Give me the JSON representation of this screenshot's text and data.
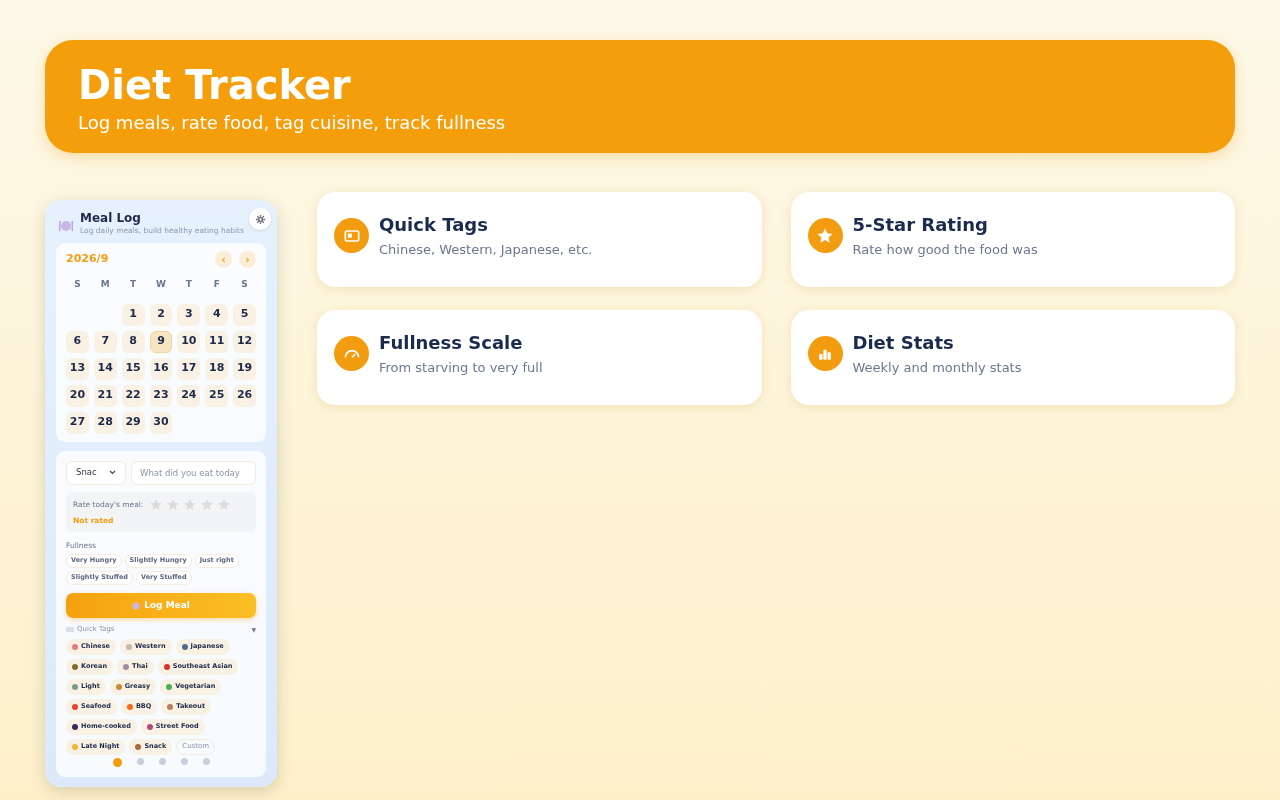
{
  "header": {
    "title": "Diet Tracker",
    "subtitle": "Log meals, rate food, tag cuisine, track fullness"
  },
  "phone": {
    "title": "Meal Log",
    "subtitle": "Log daily meals, build healthy eating habits",
    "calendar": {
      "month": "2026/9",
      "prev": "‹",
      "next": "›",
      "weekdays": [
        "S",
        "M",
        "T",
        "W",
        "T",
        "F",
        "S"
      ],
      "weeks": [
        [
          {
            "day": "1",
            "selected": false
          },
          {
            "day": "2",
            "selected": false
          },
          {
            "day": "3",
            "selected": false
          },
          {
            "day": "4",
            "selected": false
          },
          {
            "day": "5",
            "selected": false
          }
        ],
        [
          {
            "day": "6",
            "selected": false
          },
          {
            "day": "7",
            "selected": false
          },
          {
            "day": "8",
            "selected": false
          },
          {
            "day": "9",
            "selected": true
          },
          {
            "day": "10",
            "selected": false
          },
          {
            "day": "11",
            "selected": false
          },
          {
            "day": "12",
            "selected": false
          }
        ],
        [
          {
            "day": "13",
            "selected": false
          },
          {
            "day": "14",
            "selected": false
          },
          {
            "day": "15",
            "selected": false
          },
          {
            "day": "16",
            "selected": false
          },
          {
            "day": "17",
            "selected": false
          },
          {
            "day": "18",
            "selected": false
          },
          {
            "day": "19",
            "selected": false
          }
        ],
        [
          {
            "day": "20",
            "selected": false
          },
          {
            "day": "21",
            "selected": false
          },
          {
            "day": "22",
            "selected": false
          },
          {
            "day": "23",
            "selected": false
          },
          {
            "day": "24",
            "selected": false
          },
          {
            "day": "25",
            "selected": false
          },
          {
            "day": "26",
            "selected": false
          }
        ],
        [
          {
            "day": "27",
            "selected": false
          },
          {
            "day": "28",
            "selected": false
          },
          {
            "day": "29",
            "selected": false
          },
          {
            "day": "30",
            "selected": false
          }
        ]
      ]
    },
    "meal_type": "Snac",
    "food_placeholder": "What did you eat today",
    "rating": {
      "label": "Rate today's meal:",
      "stars": 0,
      "status": "Not rated"
    },
    "fullness": {
      "label": "Fullness",
      "options": [
        {
          "label": "Very Hungry",
          "selected": false
        },
        {
          "label": "Slightly Hungry",
          "selected": false
        },
        {
          "label": "Just right",
          "selected": false
        },
        {
          "label": "Slightly Stuffed",
          "selected": false
        },
        {
          "label": "Very Stuffed",
          "selected": false
        }
      ]
    },
    "log_button": "Log Meal",
    "quick_tags": {
      "label": "Quick Tags",
      "toggle": "▼",
      "expanded": true,
      "tags": [
        {
          "label": "Chinese",
          "kind": "tag",
          "color": "#e87a7a"
        },
        {
          "label": "Western",
          "kind": "tag",
          "color": "#c9b8a8"
        },
        {
          "label": "Japanese",
          "kind": "tag",
          "color": "#4f6b8a"
        },
        {
          "label": "Korean",
          "kind": "tag",
          "color": "#8a6a2a"
        },
        {
          "label": "Thai",
          "kind": "tag",
          "color": "#9c8fa8"
        },
        {
          "label": "Southeast Asian",
          "kind": "tag",
          "color": "#d9302a"
        },
        {
          "label": "Light",
          "kind": "tag",
          "color": "#7a9a8a"
        },
        {
          "label": "Greasy",
          "kind": "tag",
          "color": "#c98a3a"
        },
        {
          "label": "Vegetarian",
          "kind": "tag",
          "color": "#4caf50"
        },
        {
          "label": "Seafood",
          "kind": "tag",
          "color": "#e0452e"
        },
        {
          "label": "BBQ",
          "kind": "tag",
          "color": "#f26a1b"
        },
        {
          "label": "Takeout",
          "kind": "tag",
          "color": "#b5815a"
        },
        {
          "label": "Home-cooked",
          "kind": "tag",
          "color": "#3b2a5a"
        },
        {
          "label": "Street Food",
          "kind": "tag",
          "color": "#b04a7a"
        },
        {
          "label": "Late Night",
          "kind": "tag",
          "color": "#f2b33a"
        },
        {
          "label": "Snack",
          "kind": "tag",
          "color": "#a86a3a"
        },
        {
          "label": "Custom",
          "kind": "custom"
        }
      ]
    },
    "pages": [
      {
        "selected": true
      },
      {
        "selected": false
      },
      {
        "selected": false
      },
      {
        "selected": false
      },
      {
        "selected": false
      }
    ]
  },
  "features": [
    {
      "kind": "tag",
      "title": "Quick Tags",
      "description": "Chinese, Western, Japanese, etc."
    },
    {
      "kind": "star",
      "title": "5-Star Rating",
      "description": "Rate how good the food was"
    },
    {
      "kind": "gauge",
      "title": "Fullness Scale",
      "description": "From starving to very full"
    },
    {
      "kind": "chart",
      "title": "Diet Stats",
      "description": "Weekly and monthly stats"
    }
  ]
}
